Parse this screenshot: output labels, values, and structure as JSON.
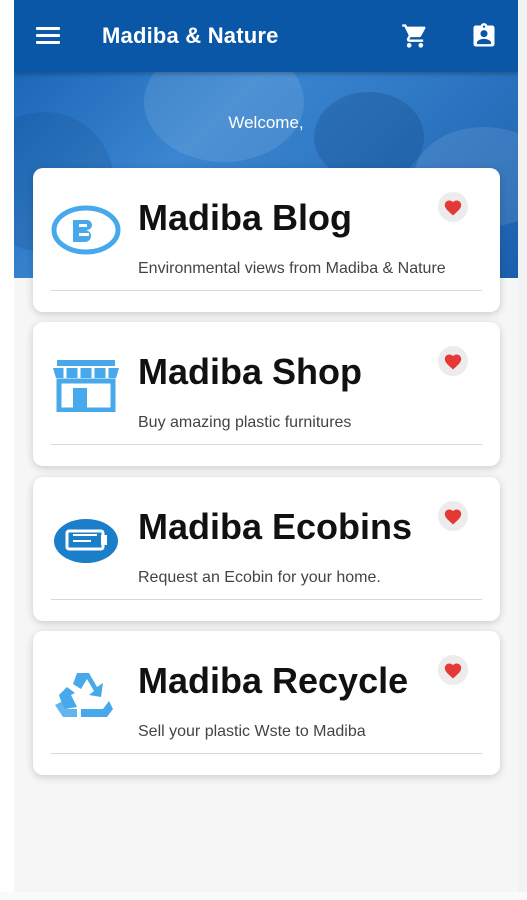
{
  "app": {
    "title": "Madiba & Nature",
    "brand_color": "#0a57a8",
    "icons": {
      "menu": "menu-icon",
      "cart": "cart-icon",
      "profile": "profile-badge-icon"
    }
  },
  "hero": {
    "welcome": "Welcome,"
  },
  "cards": [
    {
      "title": "Madiba Blog",
      "subtitle": "Environmental views from Madiba & Nature",
      "icon": "blog-icon",
      "favorite": true
    },
    {
      "title": "Madiba Shop",
      "subtitle": "Buy amazing plastic furnitures",
      "icon": "shop-icon",
      "favorite": true
    },
    {
      "title": "Madiba Ecobins",
      "subtitle": "Request an Ecobin for your home.",
      "icon": "ecobin-icon",
      "favorite": true
    },
    {
      "title": "Madiba Recycle",
      "subtitle": "Sell your plastic Wste to Madiba",
      "icon": "recycle-icon",
      "favorite": true
    }
  ],
  "colors": {
    "icon_blue": "#47a9ec",
    "heart_red": "#e53935"
  }
}
